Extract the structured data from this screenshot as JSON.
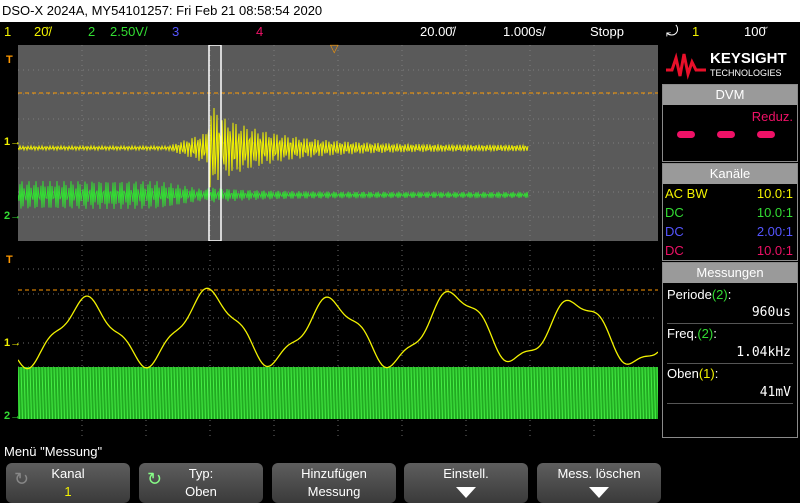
{
  "title": "DSO-X 2024A, MY54101257: Fri Feb 21 08:58:54 2020",
  "status": {
    "ch1_num": "1",
    "ch1_scale": "20̆/",
    "ch2_num": "2",
    "ch2_scale": "2.50V/",
    "ch3_num": "3",
    "ch4_num": "4",
    "time_offset": "20.00̆/",
    "time_base": "1.000s/",
    "run_state": "Stopp",
    "trigger_icon": "trigger-icon",
    "trigger_ch": "1",
    "trigger_level": "100̆"
  },
  "brand": {
    "name": "KEYSIGHT",
    "sub": "TECHNOLOGIES"
  },
  "dvm": {
    "header": "DVM",
    "mode": "Reduz."
  },
  "channels": {
    "header": "Kanäle",
    "rows": [
      {
        "coupling": "AC BW",
        "ratio": "10.0:1",
        "color": "#f2f200"
      },
      {
        "coupling": "DC",
        "ratio": "10.0:1",
        "color": "#33dd33"
      },
      {
        "coupling": "DC",
        "ratio": "2.00:1",
        "color": "#5555ff"
      },
      {
        "coupling": "DC",
        "ratio": "10.0:1",
        "color": "#ee1166"
      }
    ]
  },
  "measurements": {
    "header": "Messungen",
    "items": [
      {
        "label": "Periode",
        "src": "(2)",
        "src_color": "#33dd33",
        "colon": ":",
        "value": "960us"
      },
      {
        "label": "Freq.",
        "src": "(2)",
        "src_color": "#33dd33",
        "colon": ":",
        "value": "1.04kHz"
      },
      {
        "label": "Oben",
        "src": "(1)",
        "src_color": "#f2f200",
        "colon": ":",
        "value": "41mV"
      }
    ]
  },
  "menu": {
    "label": "Menü \"Messung\""
  },
  "softkeys": [
    {
      "l1": "Kanal",
      "l2": "1"
    },
    {
      "l1": "Typ:",
      "l2": "Oben"
    },
    {
      "l1": "Hinzufügen",
      "l2": "Messung"
    },
    {
      "l1": "Einstell.",
      "l2": ""
    },
    {
      "l1": "Mess. löschen",
      "l2": ""
    }
  ],
  "colors": {
    "ch1": "#f2f200",
    "ch2": "#33dd33",
    "ch3": "#5555ff",
    "ch4": "#ee1166",
    "trigger": "#ff9900",
    "keysight_red": "#e8102a"
  }
}
